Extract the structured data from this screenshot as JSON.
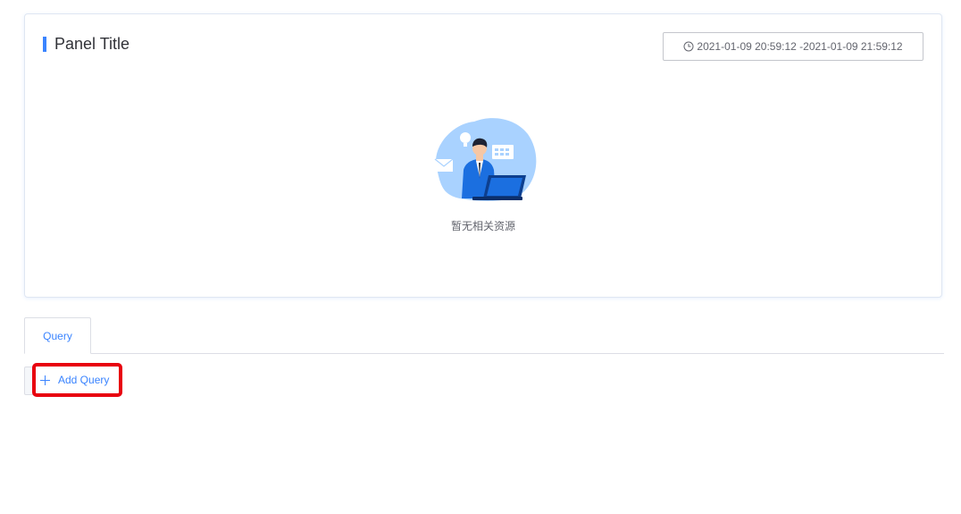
{
  "panel": {
    "title": "Panel Title",
    "time_range": "2021-01-09 20:59:12 -2021-01-09 21:59:12",
    "time_icon": "clock-icon",
    "empty_text": "暂无相关资源",
    "empty_icon": "empty-illustration"
  },
  "tabs": [
    {
      "label": "Query",
      "active": true
    }
  ],
  "actions": {
    "add_query_label": "Add Query",
    "add_query_icon": "plus-icon"
  },
  "colors": {
    "accent": "#3a84ff",
    "highlight_border": "#e8000e",
    "text_secondary": "#63656e",
    "border": "#dcdee5"
  }
}
